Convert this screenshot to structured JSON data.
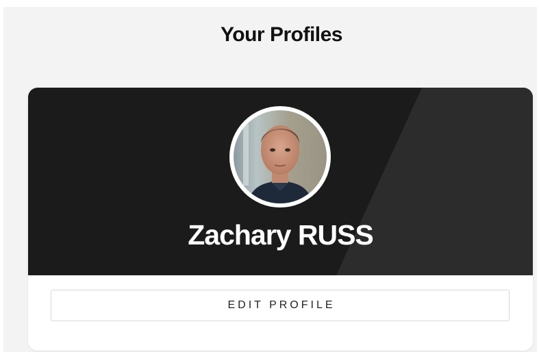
{
  "header": {
    "title": "Your Profiles"
  },
  "profile_card": {
    "name": "Zachary RUSS",
    "avatar_icon": "user-avatar-photo",
    "edit_label": "EDIT PROFILE"
  },
  "colors": {
    "page_background": "#f3f3f3",
    "banner_dark": "#1b1b1b",
    "banner_stripe": "#2c2c2c",
    "card_background": "#ffffff",
    "name_text": "#ffffff"
  }
}
